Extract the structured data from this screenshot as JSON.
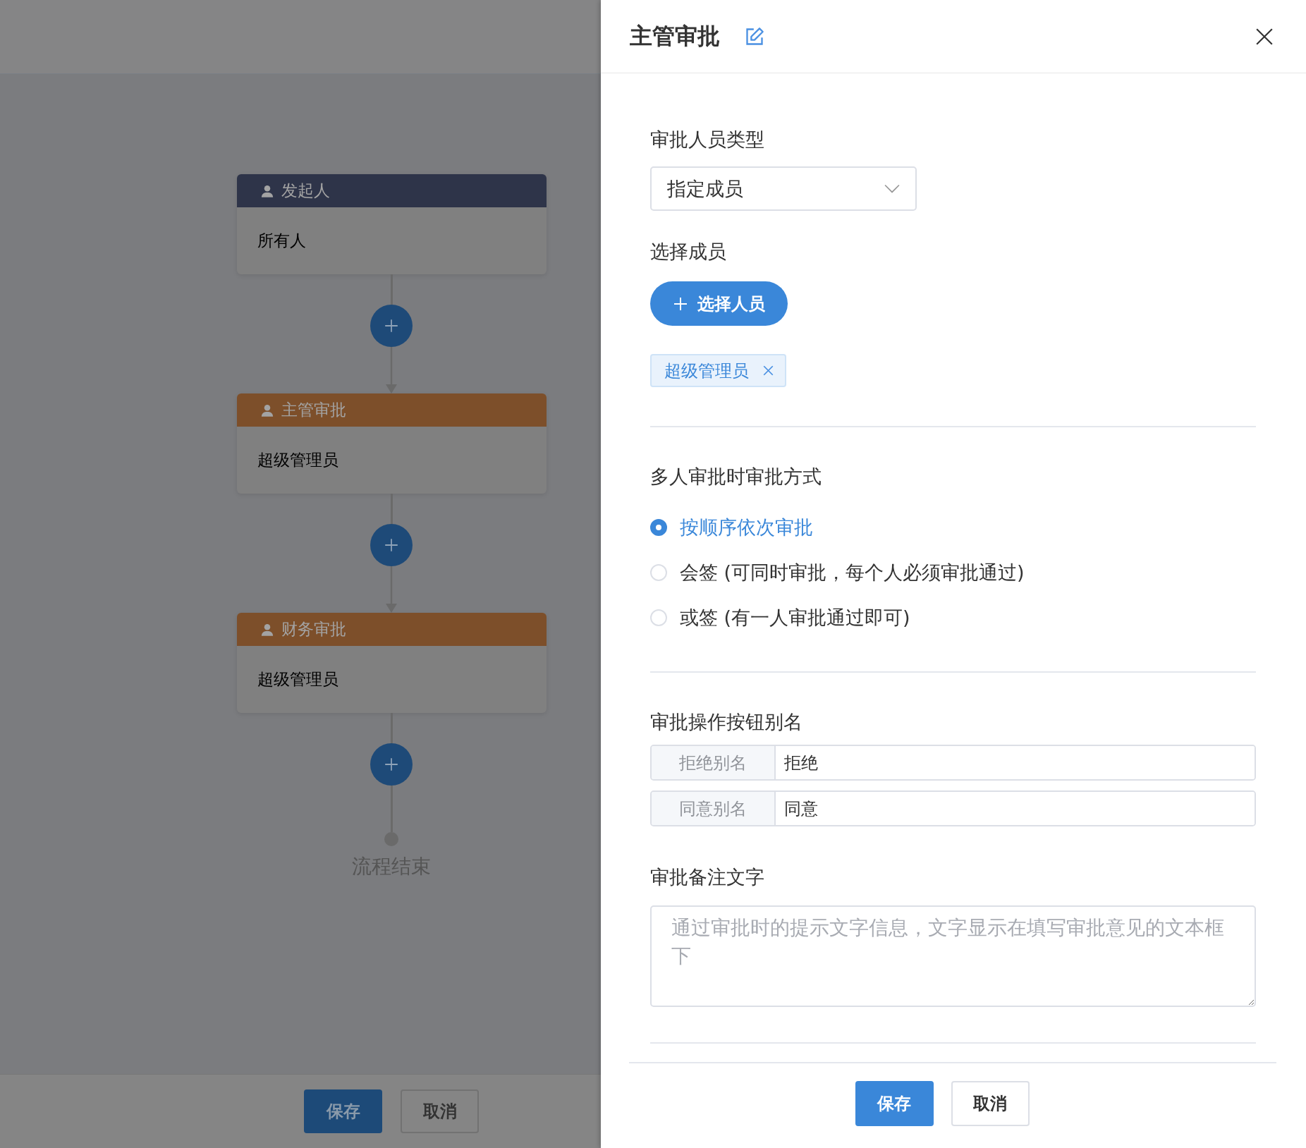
{
  "flow": {
    "nodes": [
      {
        "kind": "start",
        "title": "发起人",
        "content": "所有人"
      },
      {
        "kind": "approver",
        "title": "主管审批",
        "content": "超级管理员"
      },
      {
        "kind": "approver",
        "title": "财务审批",
        "content": "超级管理员"
      }
    ],
    "end_label": "流程结束",
    "footer_buttons": [
      {
        "kind": "primary",
        "label": "保存"
      },
      {
        "kind": "default",
        "label": "取消"
      }
    ]
  },
  "drawer": {
    "title": "主管审批",
    "approver_type": {
      "label": "审批人员类型",
      "value": "指定成员"
    },
    "members": {
      "label": "选择成员",
      "button": "选择人员",
      "tags": [
        "超级管理员"
      ]
    },
    "mode": {
      "label": "多人审批时审批方式",
      "options": [
        {
          "label": "按顺序依次审批",
          "selected": true
        },
        {
          "label": "会签 (可同时审批，每个人必须审批通过)",
          "selected": false
        },
        {
          "label": "或签 (有一人审批通过即可)",
          "selected": false
        }
      ]
    },
    "aliases": {
      "label": "审批操作按钮别名",
      "rows": [
        {
          "prefix": "拒绝别名",
          "value": "拒绝"
        },
        {
          "prefix": "同意别名",
          "value": "同意"
        }
      ]
    },
    "remark": {
      "label": "审批备注文字",
      "placeholder": "通过审批时的提示文字信息，文字显示在填写审批意见的文本框下"
    },
    "footer_buttons": [
      {
        "kind": "primary",
        "label": "保存"
      },
      {
        "kind": "default",
        "label": "取消"
      }
    ]
  }
}
